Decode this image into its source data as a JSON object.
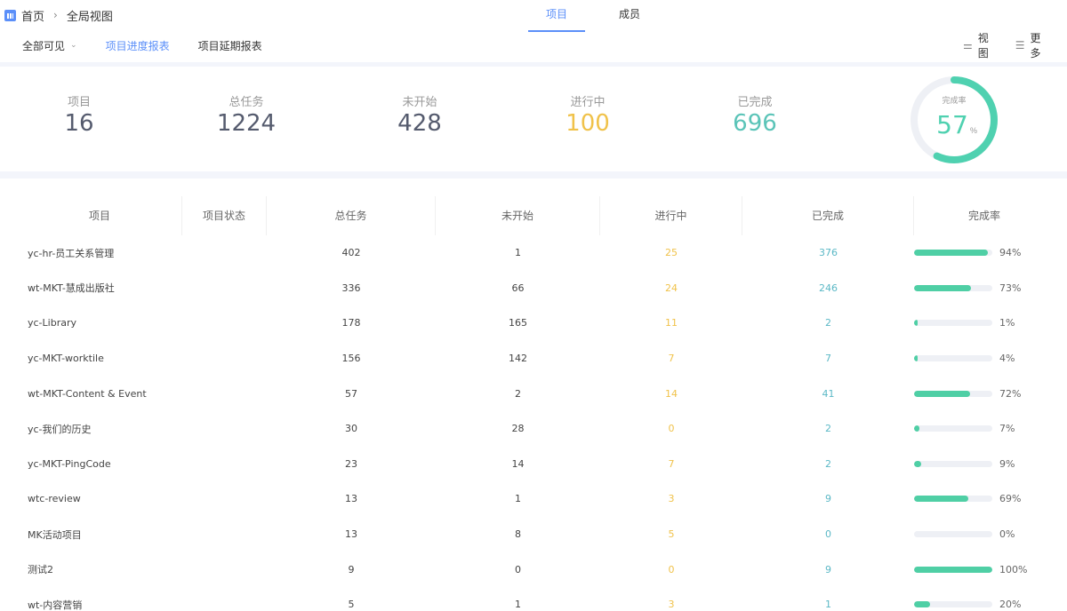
{
  "breadcrumb": {
    "home": "首页",
    "current": "全局视图"
  },
  "tabs": [
    {
      "label": "项目",
      "active": true
    },
    {
      "label": "成员",
      "active": false
    }
  ],
  "subnav": [
    {
      "label": "全部可见",
      "dropdown": true,
      "active": false
    },
    {
      "label": "项目进度报表",
      "active": true
    },
    {
      "label": "项目延期报表",
      "active": false
    }
  ],
  "tools": [
    {
      "label": "视图",
      "icon": "sliders-icon"
    },
    {
      "label": "更多",
      "icon": "list-icon"
    }
  ],
  "stats": [
    {
      "label": "项目",
      "value": "16",
      "color": "#555b6e"
    },
    {
      "label": "总任务",
      "value": "1224",
      "color": "#555b6e"
    },
    {
      "label": "未开始",
      "value": "428",
      "color": "#555b6e"
    },
    {
      "label": "进行中",
      "value": "100",
      "color": "#f0c24a"
    },
    {
      "label": "已完成",
      "value": "696",
      "color": "#5bc4b8"
    }
  ],
  "completion": {
    "label": "完成率",
    "value": "57",
    "unit": "%",
    "fraction": 0.57
  },
  "table": {
    "headers": [
      "项目",
      "项目状态",
      "总任务",
      "未开始",
      "进行中",
      "已完成",
      "完成率"
    ],
    "rows": [
      {
        "name": "yc-hr-员工关系管理",
        "total": "402",
        "not_started": "1",
        "in_progress": "25",
        "done": "376",
        "rate": 0.94,
        "rate_label": "94%"
      },
      {
        "name": "wt-MKT-慧成出版社",
        "total": "336",
        "not_started": "66",
        "in_progress": "24",
        "done": "246",
        "rate": 0.73,
        "rate_label": "73%"
      },
      {
        "name": "yc-Library",
        "total": "178",
        "not_started": "165",
        "in_progress": "11",
        "done": "2",
        "rate": 0.01,
        "rate_label": "1%"
      },
      {
        "name": "yc-MKT-worktile",
        "total": "156",
        "not_started": "142",
        "in_progress": "7",
        "done": "7",
        "rate": 0.04,
        "rate_label": "4%"
      },
      {
        "name": "wt-MKT-Content & Event",
        "total": "57",
        "not_started": "2",
        "in_progress": "14",
        "done": "41",
        "rate": 0.72,
        "rate_label": "72%"
      },
      {
        "name": "yc-我们的历史",
        "total": "30",
        "not_started": "28",
        "in_progress": "0",
        "done": "2",
        "rate": 0.07,
        "rate_label": "7%"
      },
      {
        "name": "yc-MKT-PingCode",
        "total": "23",
        "not_started": "14",
        "in_progress": "7",
        "done": "2",
        "rate": 0.09,
        "rate_label": "9%"
      },
      {
        "name": "wtc-review",
        "total": "13",
        "not_started": "1",
        "in_progress": "3",
        "done": "9",
        "rate": 0.69,
        "rate_label": "69%"
      },
      {
        "name": "MK活动项目",
        "total": "13",
        "not_started": "8",
        "in_progress": "5",
        "done": "0",
        "rate": 0.0,
        "rate_label": "0%"
      },
      {
        "name": "测试2",
        "total": "9",
        "not_started": "0",
        "in_progress": "0",
        "done": "9",
        "rate": 1.0,
        "rate_label": "100%"
      },
      {
        "name": "wt-内容营销",
        "total": "5",
        "not_started": "1",
        "in_progress": "3",
        "done": "1",
        "rate": 0.2,
        "rate_label": "20%"
      }
    ]
  },
  "colors": {
    "accent": "#5b8ff9",
    "progress": "#f0c24a",
    "done": "#5bc4b8",
    "bar": "#4fcfa5"
  }
}
